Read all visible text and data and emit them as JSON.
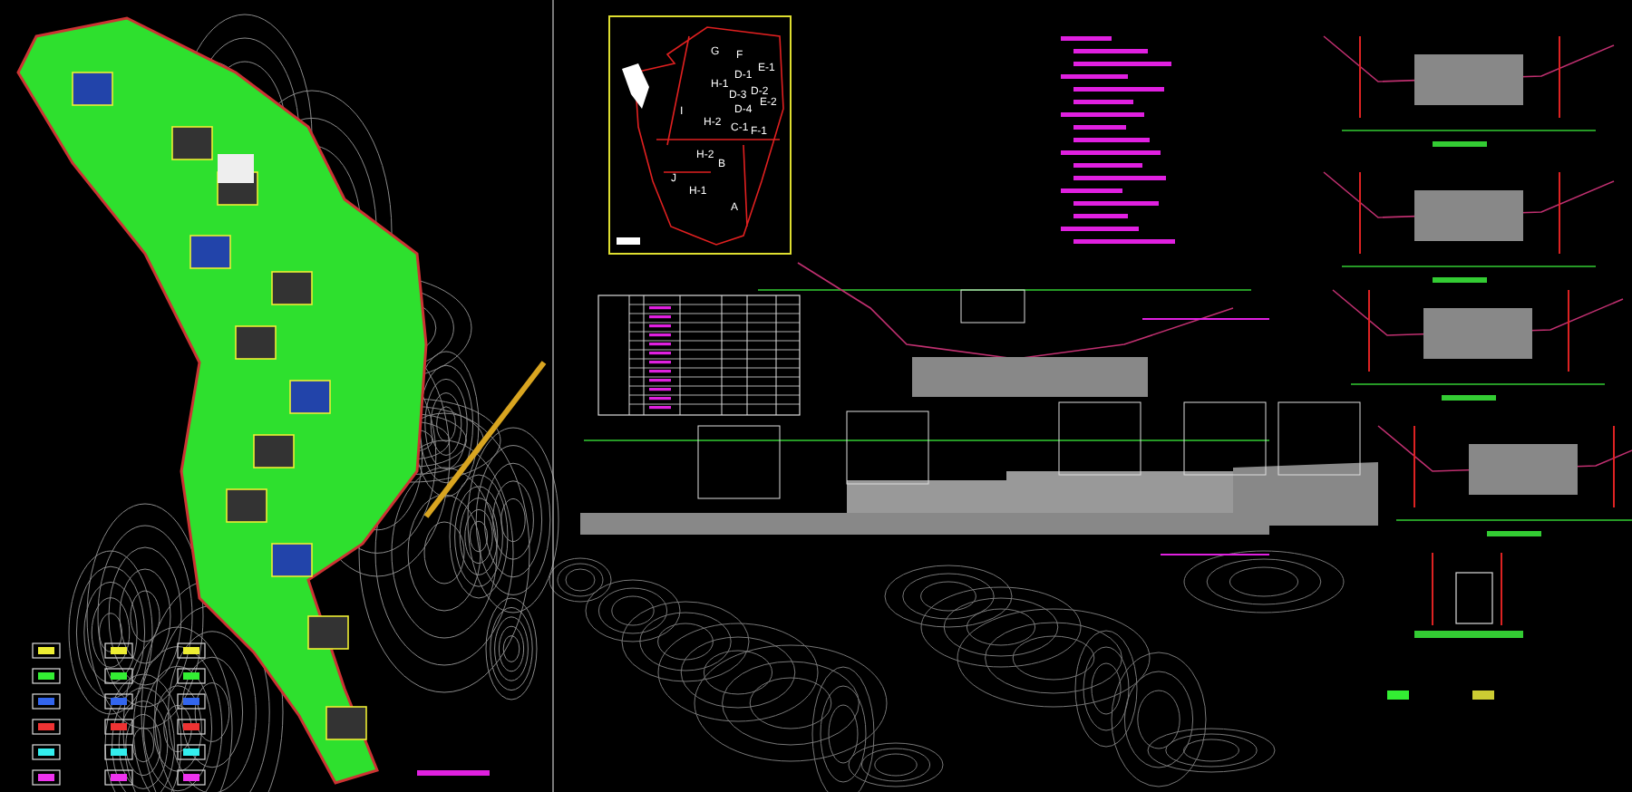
{
  "inset_map": {
    "zone_labels": [
      {
        "text": "G"
      },
      {
        "text": "F"
      },
      {
        "text": "H-1"
      },
      {
        "text": "D-1"
      },
      {
        "text": "E-1"
      },
      {
        "text": "D-3"
      },
      {
        "text": "D-2"
      },
      {
        "text": "E-2"
      },
      {
        "text": "D-4"
      },
      {
        "text": "I"
      },
      {
        "text": "H-2"
      },
      {
        "text": "C-1"
      },
      {
        "text": "F-1"
      },
      {
        "text": "H-2"
      },
      {
        "text": "B"
      },
      {
        "text": "J"
      },
      {
        "text": "H-1"
      },
      {
        "text": "A"
      }
    ]
  }
}
